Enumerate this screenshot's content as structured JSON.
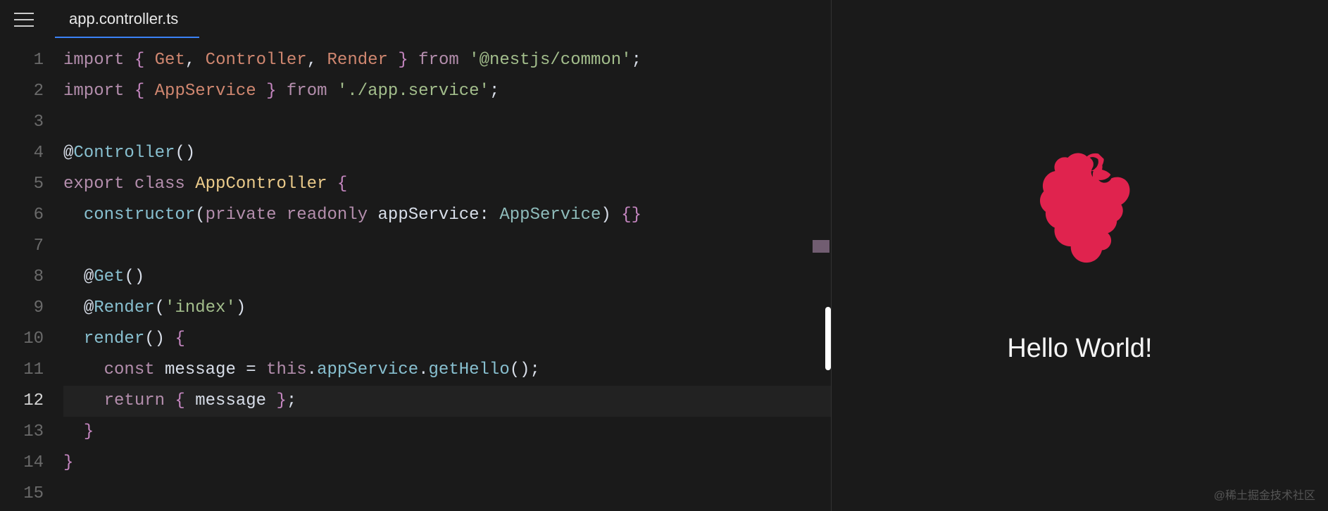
{
  "tab": {
    "filename": "app.controller.ts"
  },
  "editor": {
    "lines": [
      1,
      2,
      3,
      4,
      5,
      6,
      7,
      8,
      9,
      10,
      11,
      12,
      13,
      14,
      15
    ],
    "current_line": 12,
    "code": {
      "l1_import": "import",
      "l1_brace_open": " { ",
      "l1_get": "Get",
      "l1_comma1": ", ",
      "l1_controller": "Controller",
      "l1_comma2": ", ",
      "l1_render": "Render",
      "l1_brace_close": " } ",
      "l1_from": "from",
      "l1_space": " ",
      "l1_string": "'@nestjs/common'",
      "l1_semi": ";",
      "l2_import": "import",
      "l2_brace_open": " { ",
      "l2_appservice": "AppService",
      "l2_brace_close": " } ",
      "l2_from": "from",
      "l2_space": " ",
      "l2_string": "'./app.service'",
      "l2_semi": ";",
      "l4_at": "@",
      "l4_decorator": "Controller",
      "l4_parens": "()",
      "l5_export": "export",
      "l5_class": " class ",
      "l5_name": "AppController",
      "l5_brace": " {",
      "l6_indent": "  ",
      "l6_constructor": "constructor",
      "l6_paren_open": "(",
      "l6_private": "private",
      "l6_readonly": " readonly ",
      "l6_param": "appService",
      "l6_colon": ": ",
      "l6_type": "AppService",
      "l6_paren_close": ")",
      "l6_body": " {}",
      "l8_indent": "  ",
      "l8_at": "@",
      "l8_decorator": "Get",
      "l8_parens": "()",
      "l9_indent": "  ",
      "l9_at": "@",
      "l9_decorator": "Render",
      "l9_paren_open": "(",
      "l9_string": "'index'",
      "l9_paren_close": ")",
      "l10_indent": "  ",
      "l10_method": "render",
      "l10_parens": "()",
      "l10_brace": " {",
      "l11_indent": "    ",
      "l11_const": "const",
      "l11_var": " message ",
      "l11_eq": "= ",
      "l11_this": "this",
      "l11_dot1": ".",
      "l11_prop": "appService",
      "l11_dot2": ".",
      "l11_method": "getHello",
      "l11_parens": "()",
      "l11_semi": ";",
      "l12_indent": "    ",
      "l12_return": "return",
      "l12_brace_open": " { ",
      "l12_var": "message",
      "l12_brace_close": " }",
      "l12_semi": ";",
      "l13_indent": "  ",
      "l13_brace": "}",
      "l14_brace": "}"
    }
  },
  "preview": {
    "text": "Hello World!"
  },
  "watermark": "@稀土掘金技术社区"
}
